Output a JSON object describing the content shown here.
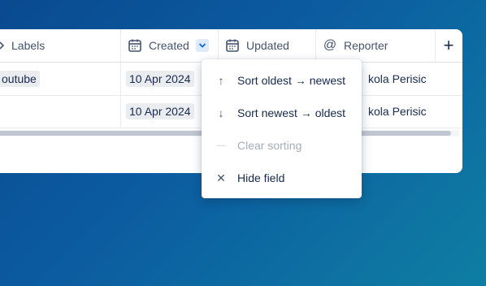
{
  "table": {
    "columns": {
      "labels": "Labels",
      "created": "Created",
      "updated": "Updated",
      "reporter": "Reporter",
      "add_symbol": "+"
    },
    "rows": [
      {
        "label": "outube",
        "created": "10 Apr 2024",
        "reporter": "kola Perisic"
      },
      {
        "label": "",
        "created": "10 Apr 2024",
        "reporter": "kola Perisic"
      }
    ]
  },
  "menu": {
    "items": [
      {
        "icon": "arrow-up-icon",
        "glyph": "↑",
        "label": "Sort oldest → newest",
        "disabled": false
      },
      {
        "icon": "arrow-down-icon",
        "glyph": "↓",
        "label": "Sort newest → oldest",
        "disabled": false
      },
      {
        "icon": "dash-icon",
        "glyph": "—",
        "label": "Clear sorting",
        "disabled": true
      },
      {
        "icon": "close-icon",
        "glyph": "✕",
        "label": "Hide field",
        "disabled": false
      }
    ]
  },
  "colors": {
    "background_start": "#0a4a8f",
    "background_end": "#0f7ea3",
    "accent": "#0c66e4",
    "text": "#172b4d",
    "muted": "#44546f"
  }
}
